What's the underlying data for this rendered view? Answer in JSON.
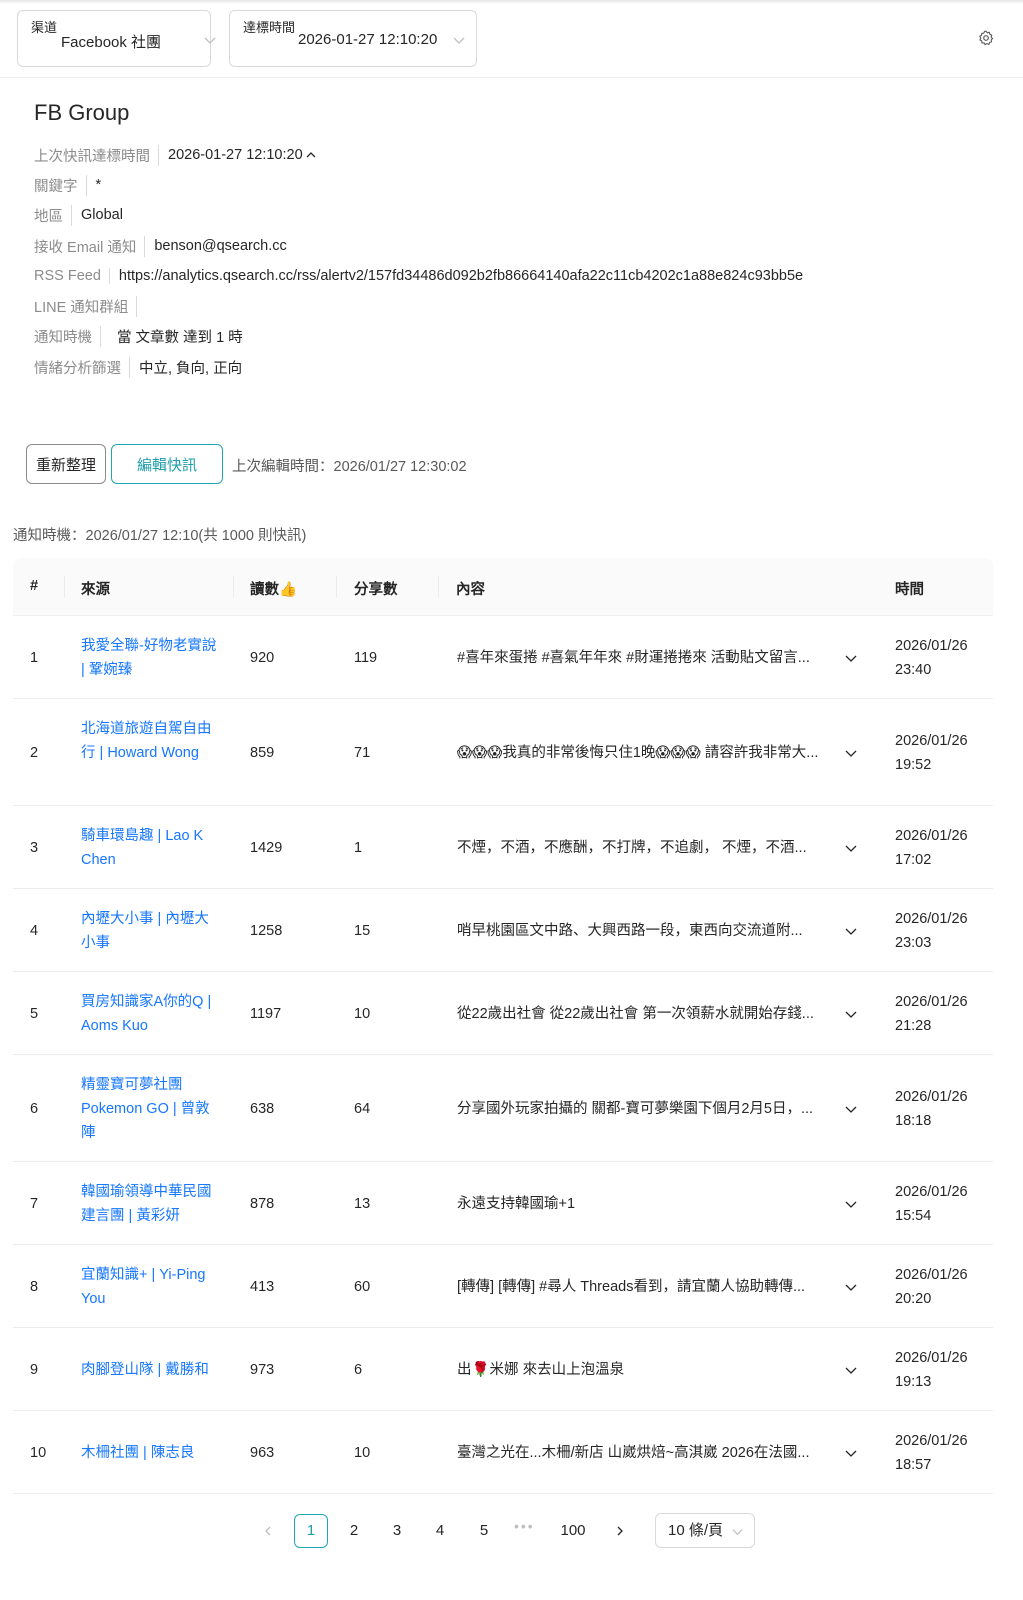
{
  "filters": {
    "channel": {
      "label": "渠道",
      "value": "Facebook 社團"
    },
    "trigger_time": {
      "label": "達標時間",
      "value": "2026-01-27 12:10:20"
    }
  },
  "icons": {
    "settings": "gear-icon",
    "dropdown": "chevron-down-icon",
    "expand": "chevron-down-icon",
    "collapse": "chevron-up-icon"
  },
  "alert": {
    "title": "FB Group",
    "fields": [
      {
        "key": "上次快訊達標時間",
        "value": "2026-01-27 12:10:20"
      },
      {
        "key": "關鍵字",
        "value": "*"
      },
      {
        "key": "地區",
        "value": "Global"
      },
      {
        "key": "接收 Email 通知",
        "value": "benson@qsearch.cc"
      },
      {
        "key": "RSS Feed",
        "value": "https://analytics.qsearch.cc/rss/alertv2/157fd34486d092b2fb86664140afa22c11cb4202c1a88e824c93bb5e"
      },
      {
        "key": "LINE 通知群組",
        "value": ""
      },
      {
        "key": "通知時機",
        "value": "當 文章數 達到 1 時"
      },
      {
        "key": "情緒分析篩選",
        "value": "中立, 負向, 正向"
      }
    ]
  },
  "actions": {
    "refresh_label": "重新整理",
    "edit_label": "編輯快訊",
    "last_edit": "上次編輯時間：2026/01/27 12:30:02"
  },
  "notify_summary": "通知時機：2026/01/27 12:10(共 1000 則快訊)",
  "table": {
    "headers": {
      "index": "#",
      "source": "來源",
      "reads": "讀數👍",
      "shares": "分享數",
      "content": "內容",
      "time": "時間"
    },
    "rows": [
      {
        "index": "1",
        "source": "我愛全聯-好物老實說 | 鞏婉臻",
        "reads": "920",
        "shares": "119",
        "content": "#喜年來蛋捲 #喜氣年年來 #財運捲捲來 活動貼文留言...",
        "date": "2026/01/26",
        "clock": "23:40"
      },
      {
        "index": "2",
        "source": "北海道旅遊自駕自由行 | Howard Wong",
        "reads": "859",
        "shares": "71",
        "content": "😱😱😱我真的非常後悔只住1晚😱😱😱 請容許我非常大...",
        "date": "2026/01/26",
        "clock": "19:52"
      },
      {
        "index": "3",
        "source": "騎車環島趣 | Lao K Chen",
        "reads": "1429",
        "shares": "1",
        "content": "不煙，不酒，不應酬，不打牌，不追劇， 不煙，不酒...",
        "date": "2026/01/26",
        "clock": "17:02"
      },
      {
        "index": "4",
        "source": "內壢大小事 | 內壢大小事",
        "reads": "1258",
        "shares": "15",
        "content": "哨早桃園區文中路、大興西路一段，東西向交流道附...",
        "date": "2026/01/26",
        "clock": "23:03"
      },
      {
        "index": "5",
        "source": "買房知識家A你的Q | Aoms Kuo",
        "reads": "1197",
        "shares": "10",
        "content": "從22歲出社會 從22歲出社會 第一次領薪水就開始存錢...",
        "date": "2026/01/26",
        "clock": "21:28"
      },
      {
        "index": "6",
        "source": "精靈寶可夢社團Pokemon GO | 曾敦陣",
        "reads": "638",
        "shares": "64",
        "content": "分享國外玩家拍攝的 關都-寶可夢樂園下個月2月5日，...",
        "date": "2026/01/26",
        "clock": "18:18"
      },
      {
        "index": "7",
        "source": "韓國瑜領導中華民國建言團 | 黃彩妍",
        "reads": "878",
        "shares": "13",
        "content": "永遠支持韓國瑜+1",
        "date": "2026/01/26",
        "clock": "15:54"
      },
      {
        "index": "8",
        "source": "宜蘭知識+ | Yi-Ping You",
        "reads": "413",
        "shares": "60",
        "content": "[轉傳] [轉傳] #尋人 Threads看到，請宜蘭人協助轉傳...",
        "date": "2026/01/26",
        "clock": "20:20"
      },
      {
        "index": "9",
        "source": "肉腳登山隊 | 戴勝和",
        "reads": "973",
        "shares": "6",
        "content": "出🌹米娜 來去山上泡溫泉",
        "date": "2026/01/26",
        "clock": "19:13"
      },
      {
        "index": "10",
        "source": "木柵社團 | 陳志良",
        "reads": "963",
        "shares": "10",
        "content": "臺灣之光在...木柵/新店 山崴烘焙~高淇崴 2026在法國...",
        "date": "2026/01/26",
        "clock": "18:57"
      }
    ]
  },
  "pagination": {
    "pages": [
      "1",
      "2",
      "3",
      "4",
      "5"
    ],
    "ellipsis": "•••",
    "last_page": "100",
    "current": "1",
    "page_size": "10 條/頁"
  }
}
